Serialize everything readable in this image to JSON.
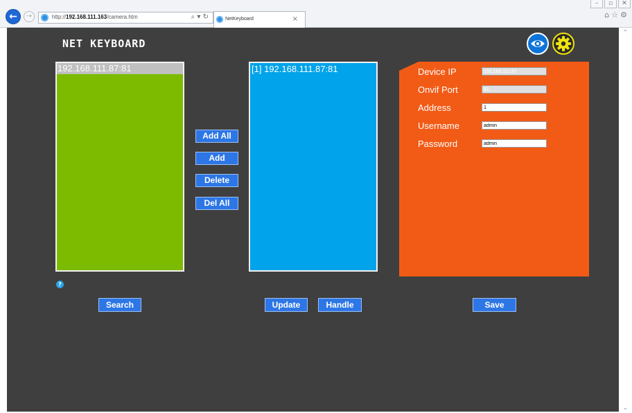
{
  "browser": {
    "url_prefix": "http://",
    "url_host": "192.168.111.163",
    "url_path": "/camera.htm",
    "address_tools": "⌕ ▾ ↻",
    "tab_title": "NetKeyboard",
    "tab_close": "×",
    "back_glyph": "←",
    "forward_glyph": "→",
    "right_tools": "⌂☆⚙",
    "window_controls": [
      "–",
      "▫",
      "✕"
    ],
    "scroll_up": "⌃",
    "scroll_down": "⌄"
  },
  "page": {
    "title": "NET KEYBOARD",
    "colors": {
      "background": "#3f3f3f",
      "search_panel": "#7cbb00",
      "device_panel": "#01a3ea",
      "settings_panel": "#f25b16",
      "button": "#2d76e6",
      "eye_icon": "#0d74d9",
      "gear_icon": "#f1e40b"
    }
  },
  "search_list": {
    "selected_item": "192.168.111.87:81"
  },
  "device_list": {
    "items": [
      "[1] 192.168.111.87:81"
    ]
  },
  "transfer_buttons": {
    "add_all": "Add All",
    "add": "Add",
    "delete": "Delete",
    "del_all": "Del All"
  },
  "device_form": {
    "device_ip_label": "Device IP",
    "device_ip_value": "192.168.111.87",
    "onvif_port_label": "Onvif Port",
    "onvif_port_value": "81",
    "address_label": "Address",
    "address_value": "1",
    "username_label": "Username",
    "username_value": "admin",
    "password_label": "Password",
    "password_value": "admin"
  },
  "bottom_buttons": {
    "search": "Search",
    "update": "Update",
    "handle": "Handle",
    "save": "Save"
  },
  "icons": {
    "header_left": "eye-icon",
    "header_right": "gear-icon",
    "help": "help-icon"
  }
}
